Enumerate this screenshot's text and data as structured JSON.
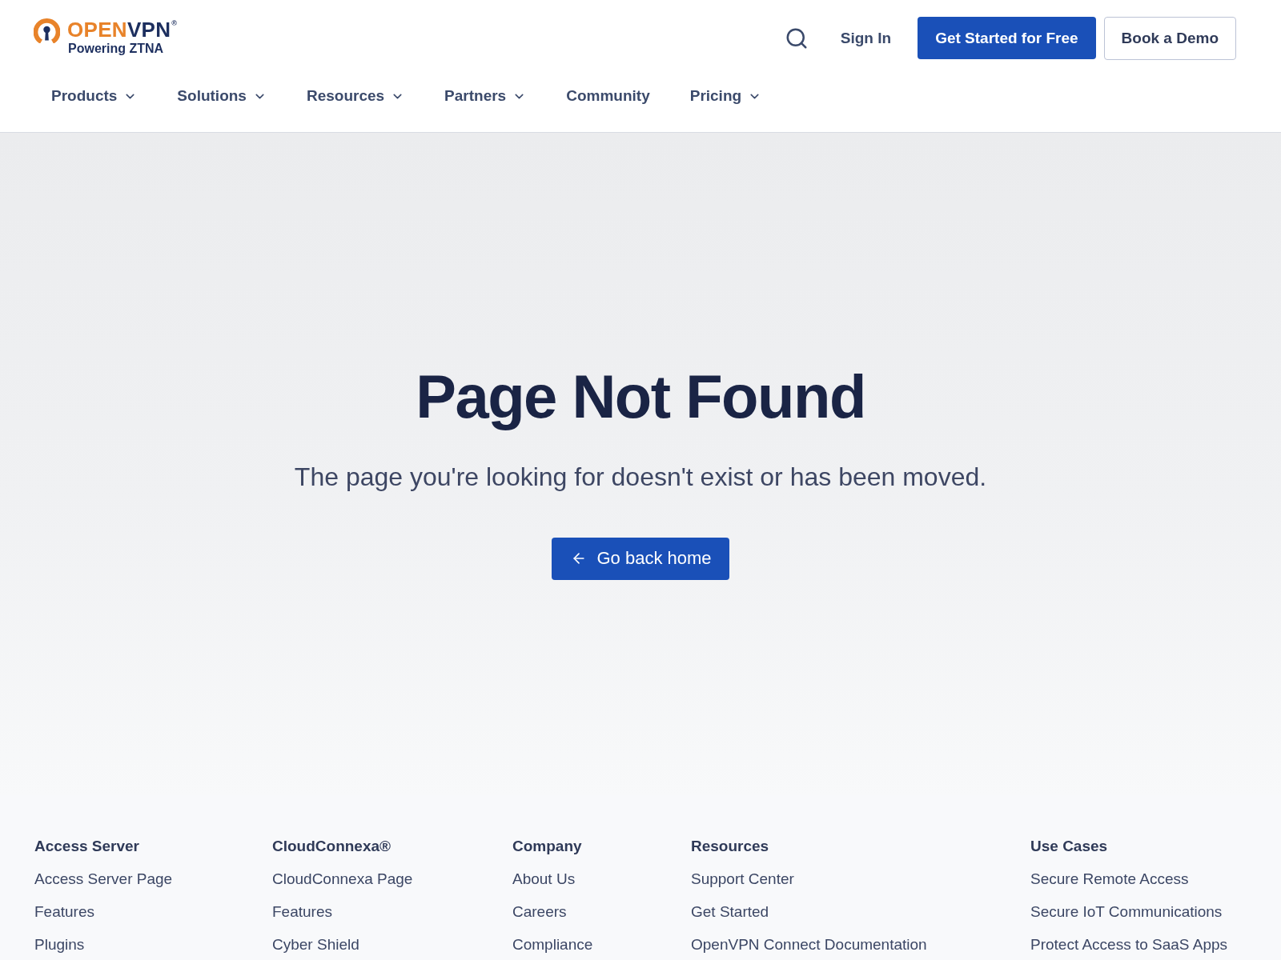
{
  "header": {
    "logo": {
      "wordmark": [
        {
          "text": "OPEN",
          "color": "#e8832a"
        },
        {
          "text": "VPN",
          "color": "#1d2f5f"
        }
      ],
      "registered": "®",
      "tagline": "Powering ZTNA"
    },
    "sign_in": "Sign In",
    "primary_button": "Get Started for Free",
    "secondary_button": "Book a Demo"
  },
  "nav": [
    {
      "label": "Products",
      "has_menu": true
    },
    {
      "label": "Solutions",
      "has_menu": true
    },
    {
      "label": "Resources",
      "has_menu": true
    },
    {
      "label": "Partners",
      "has_menu": true
    },
    {
      "label": "Community",
      "has_menu": false
    },
    {
      "label": "Pricing",
      "has_menu": true
    }
  ],
  "hero": {
    "title": "Page Not Found",
    "message": "The page you're looking for doesn't exist or has been moved.",
    "button": "Go back home"
  },
  "footer": {
    "columns": [
      {
        "heading": "Access Server",
        "links": [
          "Access Server Page",
          "Features",
          "Plugins"
        ]
      },
      {
        "heading": "CloudConnexa®",
        "links": [
          "CloudConnexa Page",
          "Features",
          "Cyber Shield"
        ]
      },
      {
        "heading": "Company",
        "links": [
          "About Us",
          "Careers",
          "Compliance"
        ]
      },
      {
        "heading": "Resources",
        "links": [
          "Support Center",
          "Get Started",
          "OpenVPN Connect Documentation"
        ]
      },
      {
        "heading": "Use Cases",
        "links": [
          "Secure Remote Access",
          "Secure IoT Communications",
          "Protect Access to SaaS Apps"
        ]
      }
    ]
  }
}
